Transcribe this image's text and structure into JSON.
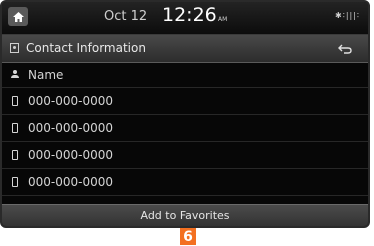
{
  "status_bar": {
    "date": "Oct 12",
    "time": "12:26",
    "ampm": "AM",
    "icons_text": "✱∶|||∶"
  },
  "title_bar": {
    "title": "Contact Information",
    "back_icon": "return-arrow"
  },
  "name_row": {
    "label": "Name"
  },
  "phone_rows": [
    {
      "number": "000-000-0000"
    },
    {
      "number": "000-000-0000"
    },
    {
      "number": "000-000-0000"
    },
    {
      "number": "000-000-0000"
    }
  ],
  "bottom_button": {
    "label": "Add to Favorites"
  },
  "callout": {
    "number": "6",
    "color": "#f37021"
  }
}
